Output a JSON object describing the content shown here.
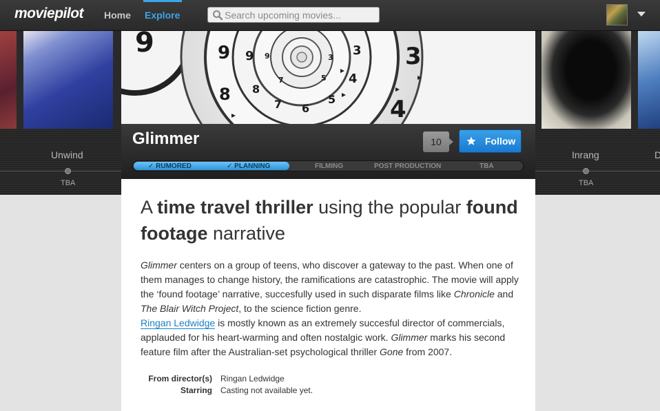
{
  "nav": {
    "logo": "moviepilot",
    "home": "Home",
    "explore": "Explore",
    "search_placeholder": "Search upcoming movies..."
  },
  "carousel": {
    "left": {
      "title": "Unwind",
      "date": "TBA"
    },
    "right": {
      "title": "Inrang",
      "date": "TBA",
      "next_initial": "D"
    }
  },
  "movie": {
    "title": "Glimmer",
    "follower_count": "10",
    "follow_label": "Follow",
    "stages": [
      {
        "label": "✓ RUMORED",
        "done": true
      },
      {
        "label": "✓ PLANNING",
        "done": true
      },
      {
        "label": "FILMING",
        "done": false
      },
      {
        "label": "POST PRODUCTION",
        "done": false
      },
      {
        "label": "TBA",
        "done": false
      }
    ],
    "progress_fraction": 0.4
  },
  "headline": {
    "p1": "A ",
    "b1": "time travel thriller",
    "p2": " using the popular ",
    "b2": "found footage",
    "p3": " narrative"
  },
  "description": {
    "s1_em": "Glimmer",
    "s1": " centers on a group of teens, who discover a gateway to the past. When one of them manages to change history, the ramifications are catastrophic. The movie will apply the ‘found footage’ narrative, succesfully used in such disparate films like ",
    "s2_em": "Chronicle",
    "s2": " and ",
    "s3_em": "The Blair Witch Project",
    "s3": ", to the science fiction genre.",
    "director_link": "Ringan Ledwidge",
    "s4": " is mostly known as an extremely succesful director of commercials, applauded for his heart-warming and often nostalgic work. ",
    "s4_em": "Glimmer",
    "s5": " marks his second feature film after the Australian-set psychological thriller ",
    "s5_em": "Gone",
    "s6": " from 2007."
  },
  "meta": {
    "director_label": "From director(s)",
    "director_value": "Ringan Ledwidge",
    "starring_label": "Starring",
    "starring_value": "Casting not available yet."
  },
  "colors": {
    "accent": "#3aa6e8",
    "topbar": "#2f2f2f",
    "band": "#252525",
    "follow": "#2a8ee0"
  }
}
